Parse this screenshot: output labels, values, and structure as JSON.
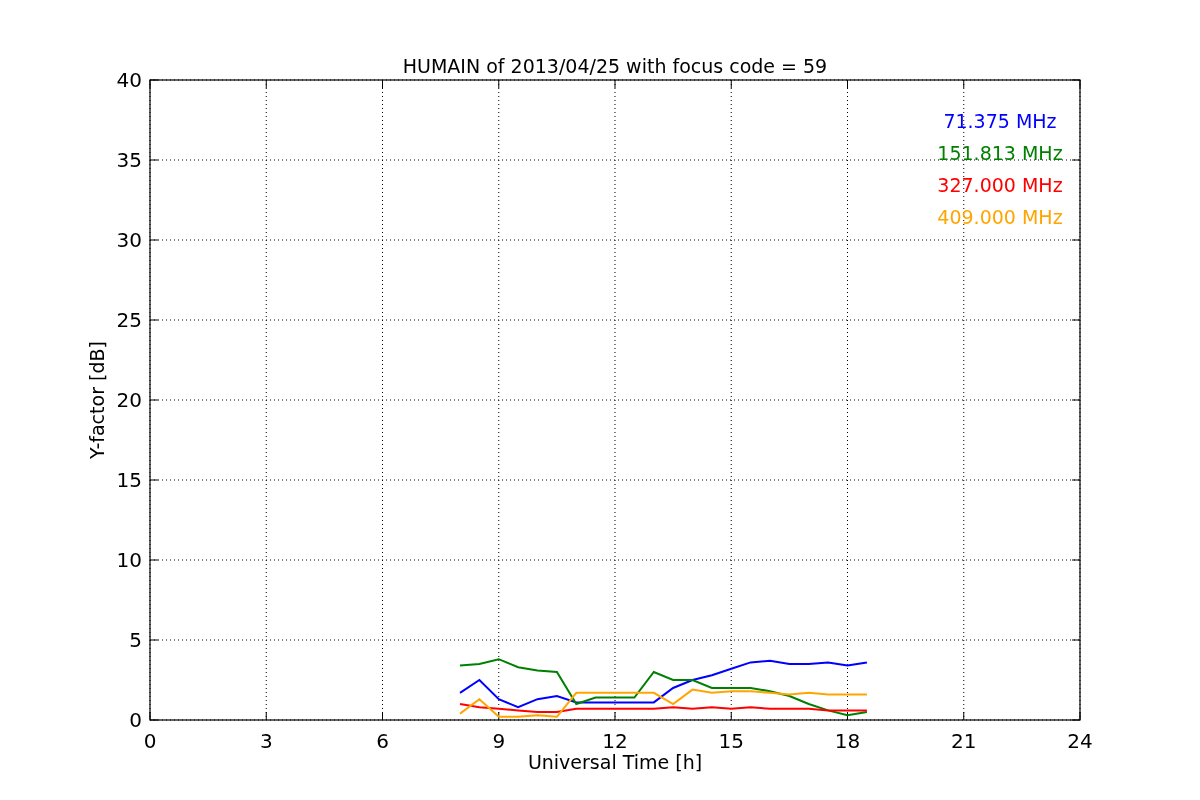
{
  "chart_data": {
    "type": "line",
    "title": "HUMAIN of 2013/04/25 with focus code = 59",
    "xlabel": "Universal Time [h]",
    "ylabel": "Y-factor [dB]",
    "x": [
      8,
      8.5,
      9,
      9.5,
      10,
      10.5,
      11,
      11.5,
      12,
      12.5,
      13,
      13.5,
      14,
      14.5,
      15,
      15.5,
      16,
      16.5,
      17,
      17.5,
      18,
      18.5
    ],
    "series": [
      {
        "name": "71.375 MHz",
        "color": "#0000ff",
        "values": [
          1.7,
          2.5,
          1.3,
          0.8,
          1.3,
          1.5,
          1.1,
          1.1,
          1.1,
          1.1,
          1.1,
          2.0,
          2.5,
          2.8,
          3.2,
          3.6,
          3.7,
          3.5,
          3.5,
          3.6,
          3.4,
          3.6
        ]
      },
      {
        "name": "151.813 MHz",
        "color": "#008000",
        "values": [
          3.4,
          3.5,
          3.8,
          3.3,
          3.1,
          3.0,
          1.0,
          1.4,
          1.4,
          1.4,
          3.0,
          2.5,
          2.5,
          2.0,
          2.0,
          2.0,
          1.8,
          1.5,
          1.0,
          0.6,
          0.3,
          0.5
        ]
      },
      {
        "name": "327.000 MHz",
        "color": "#ff0000",
        "values": [
          1.0,
          0.8,
          0.7,
          0.6,
          0.5,
          0.5,
          0.7,
          0.7,
          0.7,
          0.7,
          0.7,
          0.8,
          0.7,
          0.8,
          0.7,
          0.8,
          0.7,
          0.7,
          0.7,
          0.6,
          0.6,
          0.6
        ]
      },
      {
        "name": "409.000 MHz",
        "color": "#ffa500",
        "values": [
          0.4,
          1.3,
          0.2,
          0.2,
          0.3,
          0.2,
          1.7,
          1.7,
          1.7,
          1.7,
          1.7,
          1.0,
          1.9,
          1.7,
          1.8,
          1.8,
          1.7,
          1.6,
          1.7,
          1.6,
          1.6,
          1.6
        ]
      }
    ],
    "xlim": [
      0,
      24
    ],
    "ylim": [
      0,
      40
    ],
    "xticks": [
      0,
      3,
      6,
      9,
      12,
      15,
      18,
      21,
      24
    ],
    "yticks": [
      0,
      5,
      10,
      15,
      20,
      25,
      30,
      35,
      40
    ],
    "grid": true
  }
}
